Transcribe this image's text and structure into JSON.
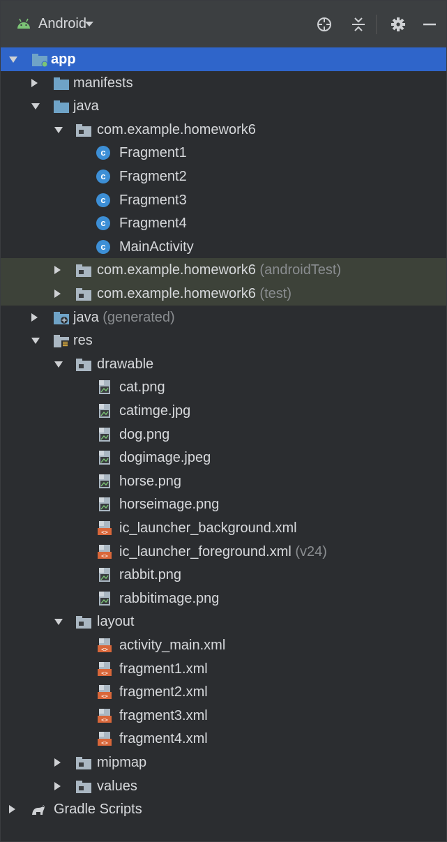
{
  "toolbar": {
    "title": "Android",
    "icons": [
      "android-icon",
      "crosshair-icon",
      "collapse-all-icon",
      "gear-icon",
      "minimize-icon"
    ]
  },
  "tree": [
    {
      "label": "app",
      "suffix": "",
      "depth": 0,
      "state": "expanded",
      "icon": "module-folder",
      "selected": true
    },
    {
      "label": "manifests",
      "suffix": "",
      "depth": 1,
      "state": "collapsed",
      "icon": "folder"
    },
    {
      "label": "java",
      "suffix": "",
      "depth": 1,
      "state": "expanded",
      "icon": "folder"
    },
    {
      "label": "com.example.homework6",
      "suffix": "",
      "depth": 2,
      "state": "expanded",
      "icon": "package"
    },
    {
      "label": "Fragment1",
      "suffix": "",
      "depth": 3,
      "state": "leaf",
      "icon": "class"
    },
    {
      "label": "Fragment2",
      "suffix": "",
      "depth": 3,
      "state": "leaf",
      "icon": "class"
    },
    {
      "label": "Fragment3",
      "suffix": "",
      "depth": 3,
      "state": "leaf",
      "icon": "class"
    },
    {
      "label": "Fragment4",
      "suffix": "",
      "depth": 3,
      "state": "leaf",
      "icon": "class"
    },
    {
      "label": "MainActivity",
      "suffix": "",
      "depth": 3,
      "state": "leaf",
      "icon": "class"
    },
    {
      "label": "com.example.homework6",
      "suffix": " (androidTest)",
      "depth": 2,
      "state": "collapsed",
      "icon": "package",
      "shaded": true
    },
    {
      "label": "com.example.homework6",
      "suffix": " (test)",
      "depth": 2,
      "state": "collapsed",
      "icon": "package",
      "shaded": true
    },
    {
      "label": "java",
      "suffix": " (generated)",
      "depth": 1,
      "state": "collapsed",
      "icon": "generated-folder"
    },
    {
      "label": "res",
      "suffix": "",
      "depth": 1,
      "state": "expanded",
      "icon": "res-folder"
    },
    {
      "label": "drawable",
      "suffix": "",
      "depth": 2,
      "state": "expanded",
      "icon": "package"
    },
    {
      "label": "cat.png",
      "suffix": "",
      "depth": 3,
      "state": "leaf",
      "icon": "image"
    },
    {
      "label": "catimge.jpg",
      "suffix": "",
      "depth": 3,
      "state": "leaf",
      "icon": "image"
    },
    {
      "label": "dog.png",
      "suffix": "",
      "depth": 3,
      "state": "leaf",
      "icon": "image"
    },
    {
      "label": "dogimage.jpeg",
      "suffix": "",
      "depth": 3,
      "state": "leaf",
      "icon": "image"
    },
    {
      "label": "horse.png",
      "suffix": "",
      "depth": 3,
      "state": "leaf",
      "icon": "image"
    },
    {
      "label": "horseimage.png",
      "suffix": "",
      "depth": 3,
      "state": "leaf",
      "icon": "image"
    },
    {
      "label": "ic_launcher_background.xml",
      "suffix": "",
      "depth": 3,
      "state": "leaf",
      "icon": "xml"
    },
    {
      "label": "ic_launcher_foreground.xml",
      "suffix": " (v24)",
      "depth": 3,
      "state": "leaf",
      "icon": "xml"
    },
    {
      "label": "rabbit.png",
      "suffix": "",
      "depth": 3,
      "state": "leaf",
      "icon": "image"
    },
    {
      "label": "rabbitimage.png",
      "suffix": "",
      "depth": 3,
      "state": "leaf",
      "icon": "image"
    },
    {
      "label": "layout",
      "suffix": "",
      "depth": 2,
      "state": "expanded",
      "icon": "package"
    },
    {
      "label": "activity_main.xml",
      "suffix": "",
      "depth": 3,
      "state": "leaf",
      "icon": "xml"
    },
    {
      "label": "fragment1.xml",
      "suffix": "",
      "depth": 3,
      "state": "leaf",
      "icon": "xml"
    },
    {
      "label": "fragment2.xml",
      "suffix": "",
      "depth": 3,
      "state": "leaf",
      "icon": "xml"
    },
    {
      "label": "fragment3.xml",
      "suffix": "",
      "depth": 3,
      "state": "leaf",
      "icon": "xml"
    },
    {
      "label": "fragment4.xml",
      "suffix": "",
      "depth": 3,
      "state": "leaf",
      "icon": "xml"
    },
    {
      "label": "mipmap",
      "suffix": "",
      "depth": 2,
      "state": "collapsed",
      "icon": "package"
    },
    {
      "label": "values",
      "suffix": "",
      "depth": 2,
      "state": "collapsed",
      "icon": "package"
    },
    {
      "label": "Gradle Scripts",
      "suffix": "",
      "depth": 0,
      "state": "collapsed",
      "icon": "gradle"
    }
  ],
  "colors": {
    "background": "#2b2d30",
    "toolbar": "#3c3f41",
    "selection": "#2f65ca",
    "shaded_row": "#3d4239",
    "folder_blue": "#6fa3c7",
    "class_badge": "#3d8fd6",
    "xml_orange": "#d9673a",
    "android_green": "#7cc576"
  }
}
